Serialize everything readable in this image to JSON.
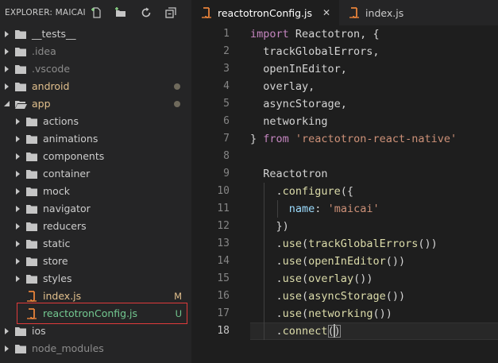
{
  "explorer": {
    "title": "EXPLORER: MAICAI",
    "actions": [
      {
        "name": "new-file-button",
        "icon": "new-file-icon"
      },
      {
        "name": "new-folder-button",
        "icon": "new-folder-icon"
      },
      {
        "name": "refresh-button",
        "icon": "refresh-icon"
      },
      {
        "name": "collapse-all-button",
        "icon": "collapse-all-icon"
      }
    ],
    "items": [
      {
        "label": "__tests__",
        "type": "folder",
        "depth": 0,
        "expanded": false,
        "labelColor": "#cccccc"
      },
      {
        "label": ".idea",
        "type": "folder",
        "depth": 0,
        "expanded": false,
        "labelColor": "#8c8c8c"
      },
      {
        "label": ".vscode",
        "type": "folder",
        "depth": 0,
        "expanded": false,
        "labelColor": "#8c8c8c"
      },
      {
        "label": "android",
        "type": "folder",
        "depth": 0,
        "expanded": false,
        "labelColor": "#e2c08d",
        "dot": true
      },
      {
        "label": "app",
        "type": "folder",
        "depth": 0,
        "expanded": true,
        "labelColor": "#e2c08d",
        "dot": true
      },
      {
        "label": "actions",
        "type": "folder",
        "depth": 1,
        "expanded": false,
        "labelColor": "#cccccc"
      },
      {
        "label": "animations",
        "type": "folder",
        "depth": 1,
        "expanded": false,
        "labelColor": "#cccccc"
      },
      {
        "label": "components",
        "type": "folder",
        "depth": 1,
        "expanded": false,
        "labelColor": "#cccccc"
      },
      {
        "label": "container",
        "type": "folder",
        "depth": 1,
        "expanded": false,
        "labelColor": "#cccccc"
      },
      {
        "label": "mock",
        "type": "folder",
        "depth": 1,
        "expanded": false,
        "labelColor": "#cccccc"
      },
      {
        "label": "navigator",
        "type": "folder",
        "depth": 1,
        "expanded": false,
        "labelColor": "#cccccc"
      },
      {
        "label": "reducers",
        "type": "folder",
        "depth": 1,
        "expanded": false,
        "labelColor": "#cccccc"
      },
      {
        "label": "static",
        "type": "folder",
        "depth": 1,
        "expanded": false,
        "labelColor": "#cccccc"
      },
      {
        "label": "store",
        "type": "folder",
        "depth": 1,
        "expanded": false,
        "labelColor": "#cccccc"
      },
      {
        "label": "styles",
        "type": "folder",
        "depth": 1,
        "expanded": false,
        "labelColor": "#cccccc"
      },
      {
        "label": "index.js",
        "type": "file",
        "depth": 1,
        "labelColor": "#e2c08d",
        "badge": "M",
        "badgeColor": "#e2c08d"
      },
      {
        "label": "reactotronConfig.js",
        "type": "file",
        "depth": 1,
        "labelColor": "#73c991",
        "badge": "U",
        "badgeColor": "#73c991",
        "highlighted": true
      },
      {
        "label": "ios",
        "type": "folder",
        "depth": 0,
        "expanded": false,
        "labelColor": "#cccccc"
      },
      {
        "label": "node_modules",
        "type": "folder",
        "depth": 0,
        "expanded": false,
        "labelColor": "#8c8c8c"
      }
    ]
  },
  "tabs": [
    {
      "label": "reactotronConfig.js",
      "active": true,
      "close": "✕",
      "labelColor": "#ffffff"
    },
    {
      "label": "index.js",
      "active": false,
      "labelColor": "#cccccc"
    }
  ],
  "colors": {
    "keyword": "#c586c0",
    "identifier": "#d4d4d4",
    "string": "#ce9178",
    "method": "#dcdcaa",
    "property": "#9cdcfe",
    "jsIcon": "#e8833a",
    "folder": "#c5c5c5"
  },
  "editor": {
    "currentLine": 18,
    "lines": [
      {
        "n": "1",
        "tokens": [
          [
            "import",
            "keyword"
          ],
          [
            " Reactotron, {",
            "identifier"
          ]
        ]
      },
      {
        "n": "2",
        "tokens": [
          [
            "  trackGlobalErrors,",
            "identifier"
          ]
        ]
      },
      {
        "n": "3",
        "tokens": [
          [
            "  openInEditor,",
            "identifier"
          ]
        ]
      },
      {
        "n": "4",
        "tokens": [
          [
            "  overlay,",
            "identifier"
          ]
        ]
      },
      {
        "n": "5",
        "tokens": [
          [
            "  asyncStorage,",
            "identifier"
          ]
        ]
      },
      {
        "n": "6",
        "tokens": [
          [
            "  networking",
            "identifier"
          ]
        ]
      },
      {
        "n": "7",
        "tokens": [
          [
            "} ",
            "identifier"
          ],
          [
            "from",
            "keyword"
          ],
          [
            " ",
            "identifier"
          ],
          [
            "'reactotron-react-native'",
            "string"
          ]
        ]
      },
      {
        "n": "8",
        "tokens": []
      },
      {
        "n": "9",
        "tokens": [
          [
            "  Reactotron",
            "identifier"
          ]
        ]
      },
      {
        "n": "10",
        "tokens": [
          [
            "    .",
            "identifier"
          ],
          [
            "configure",
            "method"
          ],
          [
            "({",
            "identifier"
          ]
        ]
      },
      {
        "n": "11",
        "tokens": [
          [
            "      ",
            "identifier"
          ],
          [
            "name",
            "property"
          ],
          [
            ": ",
            "identifier"
          ],
          [
            "'maicai'",
            "string"
          ]
        ]
      },
      {
        "n": "12",
        "tokens": [
          [
            "    })",
            "identifier"
          ]
        ]
      },
      {
        "n": "13",
        "tokens": [
          [
            "    .",
            "identifier"
          ],
          [
            "use",
            "method"
          ],
          [
            "(",
            "identifier"
          ],
          [
            "trackGlobalErrors",
            "method"
          ],
          [
            "())",
            "identifier"
          ]
        ]
      },
      {
        "n": "14",
        "tokens": [
          [
            "    .",
            "identifier"
          ],
          [
            "use",
            "method"
          ],
          [
            "(",
            "identifier"
          ],
          [
            "openInEditor",
            "method"
          ],
          [
            "())",
            "identifier"
          ]
        ]
      },
      {
        "n": "15",
        "tokens": [
          [
            "    .",
            "identifier"
          ],
          [
            "use",
            "method"
          ],
          [
            "(",
            "identifier"
          ],
          [
            "overlay",
            "method"
          ],
          [
            "())",
            "identifier"
          ]
        ]
      },
      {
        "n": "16",
        "tokens": [
          [
            "    .",
            "identifier"
          ],
          [
            "use",
            "method"
          ],
          [
            "(",
            "identifier"
          ],
          [
            "asyncStorage",
            "method"
          ],
          [
            "())",
            "identifier"
          ]
        ]
      },
      {
        "n": "17",
        "tokens": [
          [
            "    .",
            "identifier"
          ],
          [
            "use",
            "method"
          ],
          [
            "(",
            "identifier"
          ],
          [
            "networking",
            "method"
          ],
          [
            "())",
            "identifier"
          ]
        ]
      },
      {
        "n": "18",
        "tokens": [
          [
            "    .",
            "identifier"
          ],
          [
            "connect",
            "method"
          ],
          [
            "()",
            "identifier"
          ]
        ]
      }
    ]
  }
}
